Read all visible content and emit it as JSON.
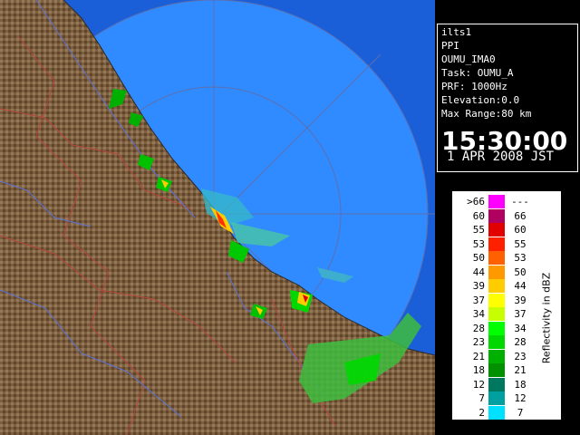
{
  "info": {
    "station": "ilts1",
    "mode": "PPI",
    "radar": "OUMU_IMA0",
    "task": "Task: OUMU_A",
    "prf": "PRF: 1000Hz",
    "elevation": "Elevation:0.0",
    "max_range": "Max Range:80 km",
    "time": "15:30:00",
    "date": "1 APR 2008 JST"
  },
  "legend": {
    "unit": "Reflectivity in dBZ",
    "rows": [
      {
        "lo": ">66",
        "hi": "---",
        "color": "#ff00ff"
      },
      {
        "lo": "60",
        "hi": "66",
        "color": "#b00060"
      },
      {
        "lo": "55",
        "hi": "60",
        "color": "#e00000"
      },
      {
        "lo": "53",
        "hi": "55",
        "color": "#ff2000"
      },
      {
        "lo": "50",
        "hi": "53",
        "color": "#ff6000"
      },
      {
        "lo": "44",
        "hi": "50",
        "color": "#ff9900"
      },
      {
        "lo": "39",
        "hi": "44",
        "color": "#ffcc00"
      },
      {
        "lo": "37",
        "hi": "39",
        "color": "#ffff00"
      },
      {
        "lo": "34",
        "hi": "37",
        "color": "#c8ff00"
      },
      {
        "lo": "28",
        "hi": "34",
        "color": "#00ff00"
      },
      {
        "lo": "23",
        "hi": "28",
        "color": "#00d800"
      },
      {
        "lo": "21",
        "hi": "23",
        "color": "#00b000"
      },
      {
        "lo": "18",
        "hi": "21",
        "color": "#009000"
      },
      {
        "lo": "12",
        "hi": "18",
        "color": "#007860"
      },
      {
        "lo": "7",
        "hi": "12",
        "color": "#00a0a0"
      },
      {
        "lo": "2",
        "hi": "7",
        "color": "#00e0ff"
      }
    ]
  },
  "colors": {
    "sea": "#1e6ef0",
    "range_ring_fill": "#2b8cff",
    "land": "#7a5c3a"
  }
}
